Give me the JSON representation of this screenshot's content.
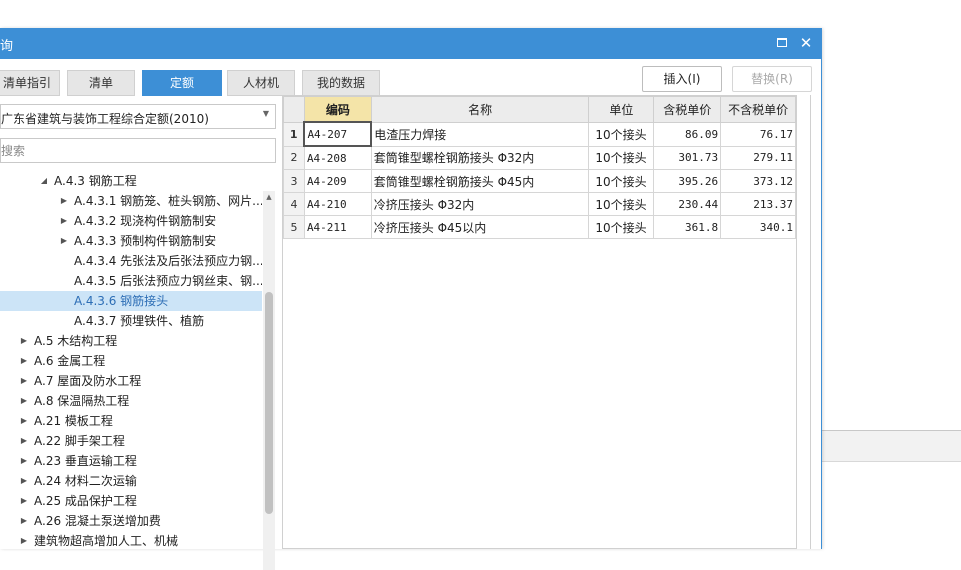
{
  "window": {
    "title": "询"
  },
  "tabs": [
    {
      "label": "清单指引",
      "active": false
    },
    {
      "label": "清单",
      "active": false
    },
    {
      "label": "定额",
      "active": true
    },
    {
      "label": "人材机",
      "active": false
    },
    {
      "label": "我的数据",
      "active": false
    }
  ],
  "actions": {
    "insert_label": "插入(I)",
    "replace_label": "替换(R)"
  },
  "library": {
    "selected": "广东省建筑与装饰工程综合定额(2010)"
  },
  "search": {
    "placeholder": "搜索"
  },
  "tree": [
    {
      "label": "A.4.3 钢筋工程",
      "toggle": "◢",
      "level": 1,
      "selected": false
    },
    {
      "label": "A.4.3.1 钢筋笼、桩头钢筋、网片...",
      "toggle": "▶",
      "level": 2,
      "selected": false
    },
    {
      "label": "A.4.3.2 现浇构件钢筋制安",
      "toggle": "▶",
      "level": 2,
      "selected": false
    },
    {
      "label": "A.4.3.3 预制构件钢筋制安",
      "toggle": "▶",
      "level": 2,
      "selected": false
    },
    {
      "label": "A.4.3.4 先张法及后张法预应力钢...",
      "toggle": "",
      "level": 2,
      "selected": false
    },
    {
      "label": "A.4.3.5 后张法预应力钢丝束、钢...",
      "toggle": "",
      "level": 2,
      "selected": false
    },
    {
      "label": "A.4.3.6 钢筋接头",
      "toggle": "",
      "level": 2,
      "selected": true
    },
    {
      "label": "A.4.3.7 预埋铁件、植筋",
      "toggle": "",
      "level": 2,
      "selected": false
    },
    {
      "label": "A.5 木结构工程",
      "toggle": "▶",
      "level": 0,
      "selected": false
    },
    {
      "label": "A.6 金属工程",
      "toggle": "▶",
      "level": 0,
      "selected": false
    },
    {
      "label": "A.7 屋面及防水工程",
      "toggle": "▶",
      "level": 0,
      "selected": false
    },
    {
      "label": "A.8 保温隔热工程",
      "toggle": "▶",
      "level": 0,
      "selected": false
    },
    {
      "label": "A.21 模板工程",
      "toggle": "▶",
      "level": 0,
      "selected": false
    },
    {
      "label": "A.22 脚手架工程",
      "toggle": "▶",
      "level": 0,
      "selected": false
    },
    {
      "label": "A.23 垂直运输工程",
      "toggle": "▶",
      "level": 0,
      "selected": false
    },
    {
      "label": "A.24 材料二次运输",
      "toggle": "▶",
      "level": 0,
      "selected": false
    },
    {
      "label": "A.25 成品保护工程",
      "toggle": "▶",
      "level": 0,
      "selected": false
    },
    {
      "label": "A.26 混凝土泵送增加费",
      "toggle": "▶",
      "level": 0,
      "selected": false
    },
    {
      "label": "建筑物超高增加人工、机械",
      "toggle": "▶",
      "level": 0,
      "selected": false
    }
  ],
  "grid": {
    "columns": [
      "编码",
      "名称",
      "单位",
      "含税单价",
      "不含税单价"
    ],
    "sorted_column": "编码",
    "rows": [
      {
        "no": "1",
        "code": "A4-207",
        "name": "电渣压力焊接",
        "unit": "10个接头",
        "price_tax": "86.09",
        "price_notax": "76.17"
      },
      {
        "no": "2",
        "code": "A4-208",
        "name": "套筒锥型螺栓钢筋接头 Φ32内",
        "unit": "10个接头",
        "price_tax": "301.73",
        "price_notax": "279.11"
      },
      {
        "no": "3",
        "code": "A4-209",
        "name": "套筒锥型螺栓钢筋接头 Φ45内",
        "unit": "10个接头",
        "price_tax": "395.26",
        "price_notax": "373.12"
      },
      {
        "no": "4",
        "code": "A4-210",
        "name": "冷挤压接头 Φ32内",
        "unit": "10个接头",
        "price_tax": "230.44",
        "price_notax": "213.37"
      },
      {
        "no": "5",
        "code": "A4-211",
        "name": "冷挤压接头 Φ45以内",
        "unit": "10个接头",
        "price_tax": "361.8",
        "price_notax": "340.1"
      }
    ],
    "current_row": 0
  },
  "colors": {
    "accent": "#3d8fd6",
    "selection": "#cce4f7",
    "sorted_header": "#f4e4a8"
  }
}
